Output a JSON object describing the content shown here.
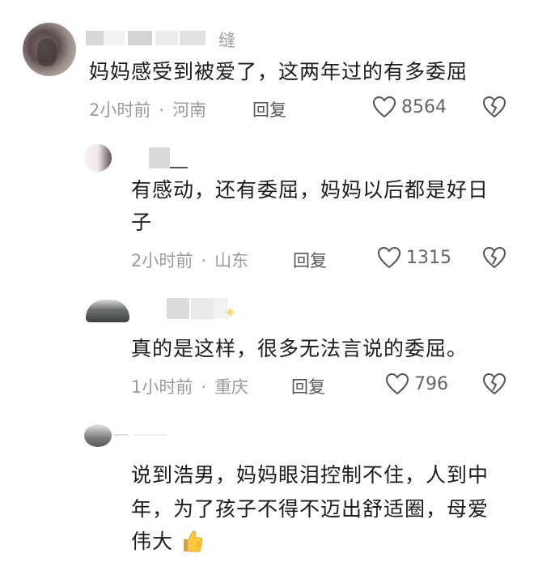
{
  "comments": [
    {
      "name_suffix": "缝",
      "text": "妈妈感受到被爱了，这两年过的有多委屈",
      "time": "2小时前",
      "dot": "·",
      "location": "河南",
      "reply": "回复",
      "likes": "8564"
    },
    {
      "text_line1": "有感动，还有委屈，妈妈以后都是好日",
      "text_line2": "子",
      "time": "2小时前",
      "dot": "·",
      "location": "山东",
      "reply": "回复",
      "likes": "1315"
    },
    {
      "text": "真的是这样，很多无法言说的委屈。",
      "time": "1小时前",
      "dot": "·",
      "location": "重庆",
      "reply": "回复",
      "likes": "796"
    },
    {
      "text_line1": "说到浩男，妈妈眼泪控制不住，人到中",
      "text_line2": "年，为了孩子不得不迈出舒适圈，母爱",
      "text_line3": "伟大",
      "emoji": "thumbs-up-icon"
    }
  ],
  "colors": {
    "meta": "#9b9b9b",
    "text": "#1b1b1b",
    "icon": "#555555"
  }
}
